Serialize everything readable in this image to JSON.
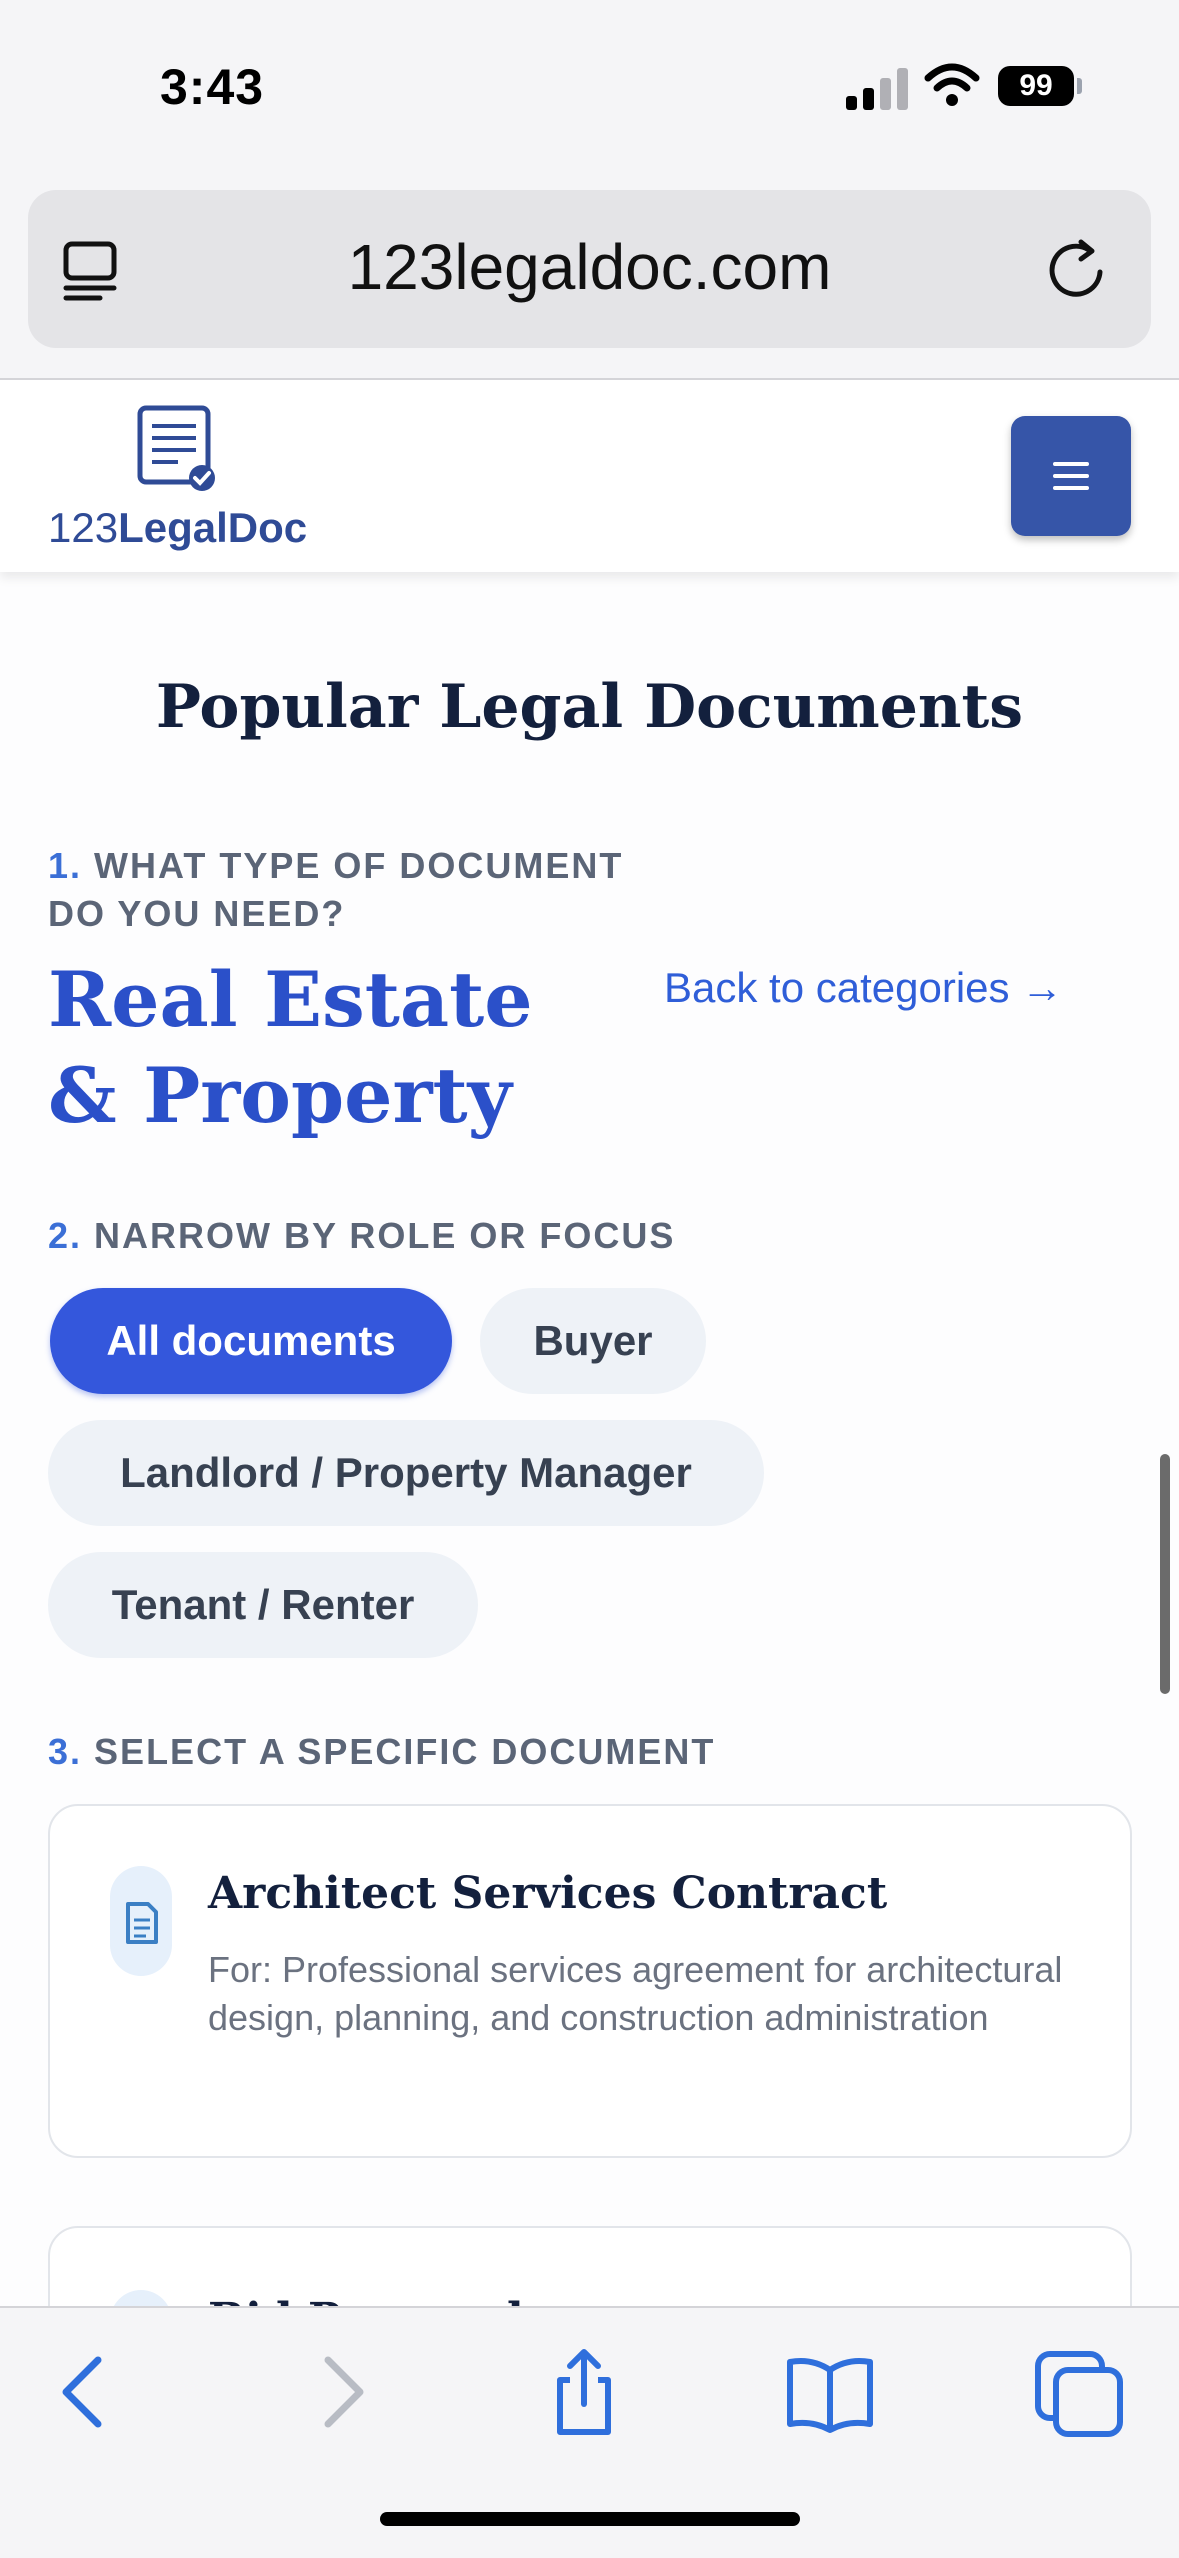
{
  "status_bar": {
    "time": "3:43",
    "battery": "99"
  },
  "browser": {
    "url": "123legaldoc.com"
  },
  "site": {
    "logo_prefix": "123",
    "logo_name": "LegalDoc"
  },
  "main": {
    "page_title": "Popular Legal Documents",
    "step1": {
      "num": "1.",
      "label": "WHAT TYPE OF DOCUMENT DO YOU NEED?"
    },
    "category_title": "Real Estate & Property",
    "back_link": "Back to categories →",
    "step2": {
      "num": "2.",
      "label": "NARROW BY ROLE OR FOCUS"
    },
    "filters": [
      {
        "label": "All documents",
        "active": true
      },
      {
        "label": "Buyer",
        "active": false
      },
      {
        "label": "Landlord / Property Manager",
        "active": false
      },
      {
        "label": "Tenant / Renter",
        "active": false
      }
    ],
    "step3": {
      "num": "3.",
      "label": "SELECT A SPECIFIC DOCUMENT"
    },
    "documents": [
      {
        "title": "Architect Services Contract",
        "description": "For: Professional services agreement for architectural design, planning, and construction administration"
      },
      {
        "title": "Bid Proposal",
        "description": ""
      }
    ]
  },
  "colors": {
    "brand": "#3655a8",
    "accent": "#3457dc",
    "link": "#2f5ed8"
  },
  "icons": {
    "reader": "reader-mode-icon",
    "reload": "reload-icon",
    "logo": "document-check-icon",
    "menu": "hamburger-menu-icon",
    "doc": "document-icon",
    "back": "chevron-left-icon",
    "forward": "chevron-right-icon",
    "share": "share-icon",
    "bookmarks": "book-icon",
    "tabs": "tabs-icon"
  }
}
